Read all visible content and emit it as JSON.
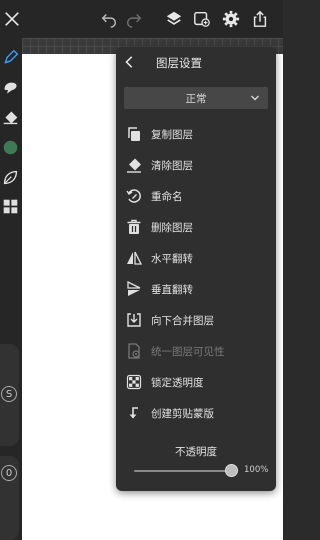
{
  "toolbar": {
    "close_icon": "close-icon",
    "undo_icon": "undo-icon",
    "redo_icon": "redo-icon",
    "layers_icon": "layers-icon",
    "gallery_icon": "gallery-icon",
    "settings_icon": "gear-icon",
    "share_icon": "share-icon"
  },
  "left_tools": [
    "pen-tool-icon",
    "smudge-tool-icon",
    "eraser-tool-icon",
    "color-swatch",
    "leaf-icon",
    "grid-icon"
  ],
  "left_sliders": {
    "size_label": "S",
    "opacity_label": "0"
  },
  "accent_color": "#3d7a55",
  "panel": {
    "title": "图层设置",
    "blend_mode": "正常",
    "items": [
      {
        "label": "复制图层",
        "icon": "copy-icon",
        "enabled": true
      },
      {
        "label": "清除图层",
        "icon": "eraser-icon",
        "enabled": true
      },
      {
        "label": "重命名",
        "icon": "rename-icon",
        "enabled": true
      },
      {
        "label": "删除图层",
        "icon": "trash-icon",
        "enabled": true
      },
      {
        "label": "水平翻转",
        "icon": "flip-horizontal-icon",
        "enabled": true
      },
      {
        "label": "垂直翻转",
        "icon": "flip-vertical-icon",
        "enabled": true
      },
      {
        "label": "向下合并图层",
        "icon": "merge-down-icon",
        "enabled": true
      },
      {
        "label": "统一图层可见性",
        "icon": "visibility-icon",
        "enabled": false
      },
      {
        "label": "锁定透明度",
        "icon": "checkerboard-icon",
        "enabled": true
      },
      {
        "label": "创建剪贴蒙版",
        "icon": "clip-arrow-icon",
        "enabled": true
      }
    ],
    "opacity_label": "不透明度",
    "opacity_value": "100%",
    "opacity_level": 1.0
  }
}
